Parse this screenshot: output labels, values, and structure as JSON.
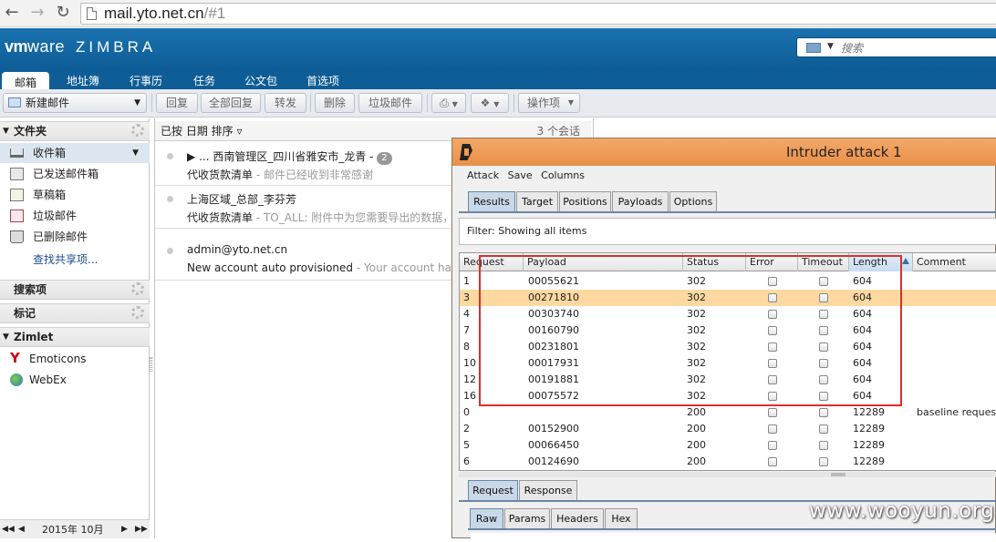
{
  "browser": {
    "url_host": "mail.yto.net.cn",
    "url_path": "/#1"
  },
  "header": {
    "brand_vm": "vm",
    "brand_ware": "ware",
    "brand_product": "ZIMBRA",
    "search_placeholder": "搜索"
  },
  "app_tabs": [
    "邮箱",
    "地址簿",
    "行事历",
    "任务",
    "公文包",
    "首选项"
  ],
  "toolbar": {
    "new_mail": "新建邮件",
    "reply": "回复",
    "reply_all": "全部回复",
    "forward": "转发",
    "delete": "删除",
    "junk": "垃圾邮件",
    "actions": "操作项"
  },
  "sidebar": {
    "folders_header": "文件夹",
    "folders": [
      "收件箱",
      "已发送邮件箱",
      "草稿箱",
      "垃圾邮件",
      "已删除邮件"
    ],
    "find_shares": "查找共享项...",
    "searches_header": "搜索项",
    "tags_header": "标记",
    "zimlet_header": "Zimlet",
    "zimlets": [
      "Emoticons",
      "WebEx"
    ],
    "calendar": "2015年 10月"
  },
  "message_list": {
    "sort_label": "已按 日期 排序",
    "count": "3 个会话",
    "messages": [
      {
        "from": "... 西南管理区_四川省雅安市_龙青 -",
        "badge": "2",
        "subject": "代收货款清单",
        "fragment": " - 邮件已经收到非常感谢"
      },
      {
        "from": "上海区域_总部_李芬芳",
        "badge": "",
        "subject": "代收货款清单",
        "fragment": " - TO_ALL: 附件中为您需要导出的数据，请"
      },
      {
        "from": "admin@yto.net.cn",
        "badge": "",
        "subject": "New account auto provisioned",
        "fragment": " - Your account has been"
      }
    ]
  },
  "burp": {
    "title": "Intruder attack 1",
    "menu": [
      "Attack",
      "Save",
      "Columns"
    ],
    "tabs": [
      "Results",
      "Target",
      "Positions",
      "Payloads",
      "Options"
    ],
    "filter": "Filter:  Showing all items",
    "columns": [
      "Request",
      "Payload",
      "Status",
      "Error",
      "Timeout",
      "Length",
      "Comment"
    ],
    "rows": [
      {
        "request": "1",
        "payload": "00055621",
        "status": "302",
        "length": "604",
        "comment": ""
      },
      {
        "request": "3",
        "payload": "00271810",
        "status": "302",
        "length": "604",
        "comment": ""
      },
      {
        "request": "4",
        "payload": "00303740",
        "status": "302",
        "length": "604",
        "comment": ""
      },
      {
        "request": "7",
        "payload": "00160790",
        "status": "302",
        "length": "604",
        "comment": ""
      },
      {
        "request": "8",
        "payload": "00231801",
        "status": "302",
        "length": "604",
        "comment": ""
      },
      {
        "request": "10",
        "payload": "00017931",
        "status": "302",
        "length": "604",
        "comment": ""
      },
      {
        "request": "12",
        "payload": "00191881",
        "status": "302",
        "length": "604",
        "comment": ""
      },
      {
        "request": "16",
        "payload": "00075572",
        "status": "302",
        "length": "604",
        "comment": ""
      },
      {
        "request": "0",
        "payload": "",
        "status": "200",
        "length": "12289",
        "comment": "baseline request"
      },
      {
        "request": "2",
        "payload": "00152900",
        "status": "200",
        "length": "12289",
        "comment": ""
      },
      {
        "request": "5",
        "payload": "00066450",
        "status": "200",
        "length": "12289",
        "comment": ""
      },
      {
        "request": "6",
        "payload": "00124690",
        "status": "200",
        "length": "12289",
        "comment": ""
      }
    ],
    "selected_row": 1,
    "detail_tabs": [
      "Request",
      "Response"
    ],
    "raw_tabs": [
      "Raw",
      "Params",
      "Headers",
      "Hex"
    ]
  },
  "watermark": "www.wooyun.org",
  "colors": {
    "zimbra_blue": "#0e5d96",
    "burp_orange": "#e8904a",
    "selected_row": "#fdd9a1",
    "highlight_box": "#d9302c"
  }
}
